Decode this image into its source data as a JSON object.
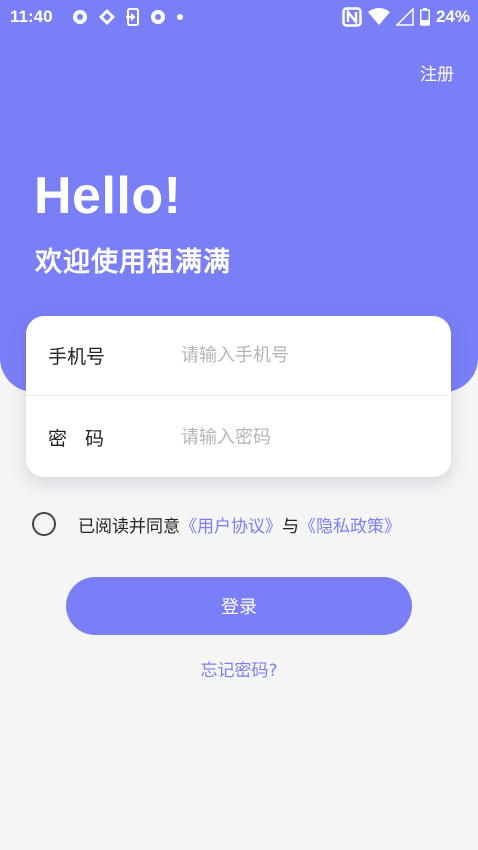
{
  "status_bar": {
    "time": "11:40",
    "battery": "24%",
    "left_icons": [
      "record-icon",
      "sync-icon",
      "phone-transfer-icon",
      "record-icon",
      "dot-icon"
    ],
    "right_icons": [
      "nfc-icon",
      "wifi-icon",
      "signal-icon",
      "battery-icon"
    ]
  },
  "header": {
    "register_label": "注册",
    "greeting": "Hello!",
    "welcome": "欢迎使用租满满"
  },
  "login_form": {
    "phone_label": "手机号",
    "phone_placeholder": "请输入手机号",
    "phone_value": "",
    "password_label": "密码",
    "password_placeholder": "请输入密码",
    "password_value": ""
  },
  "agreement": {
    "checked": false,
    "prefix": "已阅读并同意",
    "user_agreement": "《用户协议》",
    "conjunction": "与",
    "privacy_policy": "《隐私政策》"
  },
  "actions": {
    "login_label": "登录",
    "forgot_password": "忘记密码?"
  },
  "colors": {
    "accent": "#7b7ff7",
    "background": "#f5f5f5",
    "card": "#ffffff"
  }
}
